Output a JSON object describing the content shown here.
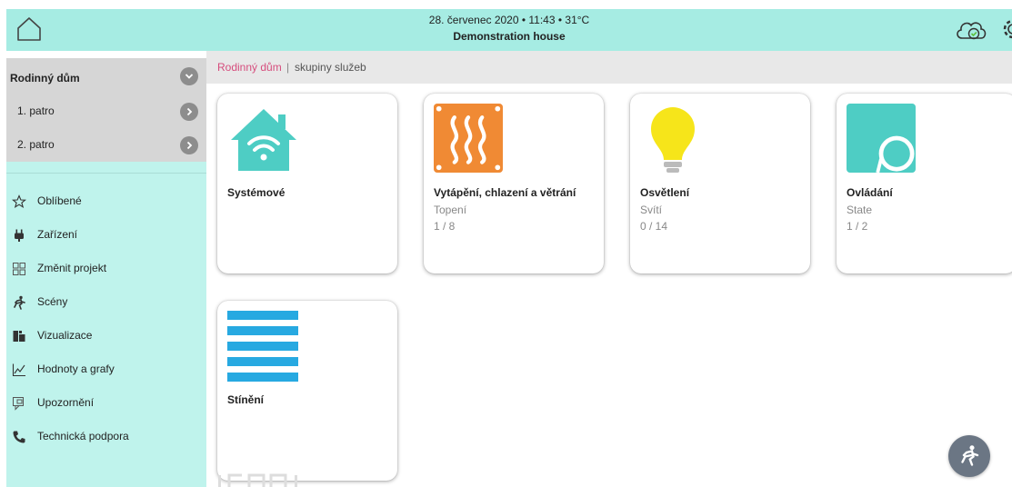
{
  "header": {
    "datetime_line": "28. červenec 2020 • 11:43 • 31°C",
    "house_name": "Demonstration house"
  },
  "sidebar": {
    "group_title": "Rodinný dům",
    "floors": [
      {
        "label": "1. patro"
      },
      {
        "label": "2. patro"
      }
    ],
    "menu": [
      {
        "label": "Oblíbené",
        "icon": "star-icon"
      },
      {
        "label": "Zařízení",
        "icon": "plug-icon"
      },
      {
        "label": "Změnit projekt",
        "icon": "project-icon"
      },
      {
        "label": "Scény",
        "icon": "scene-runner-icon"
      },
      {
        "label": "Vizualizace",
        "icon": "visualization-icon"
      },
      {
        "label": "Hodnoty a grafy",
        "icon": "chart-icon"
      },
      {
        "label": "Upozornění",
        "icon": "notification-icon"
      },
      {
        "label": "Technická podpora",
        "icon": "phone-icon"
      }
    ]
  },
  "breadcrumb": {
    "root": "Rodinný dům",
    "separator": "|",
    "current": "skupiny služeb"
  },
  "cards": [
    {
      "title": "Systémové",
      "subtitle": "",
      "count": "",
      "icon": "wifi-house-icon",
      "color": "#4ecdc4"
    },
    {
      "title": "Vytápění, chlazení a větrání",
      "subtitle": "Topení",
      "count": "1 / 8",
      "icon": "heating-icon",
      "color": "#f08a34"
    },
    {
      "title": "Osvětlení",
      "subtitle": "Svítí",
      "count": "0 / 14",
      "icon": "light-bulb-icon",
      "color": "#f6e51a"
    },
    {
      "title": "Ovládání",
      "subtitle": "State",
      "count": "1 / 2",
      "icon": "control-icon",
      "color": "#4ecdc4"
    },
    {
      "title": "Stínění",
      "subtitle": "",
      "count": "",
      "icon": "blinds-icon",
      "color": "#27a9e1"
    }
  ],
  "colors": {
    "topbar": "#a6ece3",
    "sidebar": "#bff3ec",
    "breadcrumb_link": "#d64d7d",
    "fab": "#6b7684"
  }
}
